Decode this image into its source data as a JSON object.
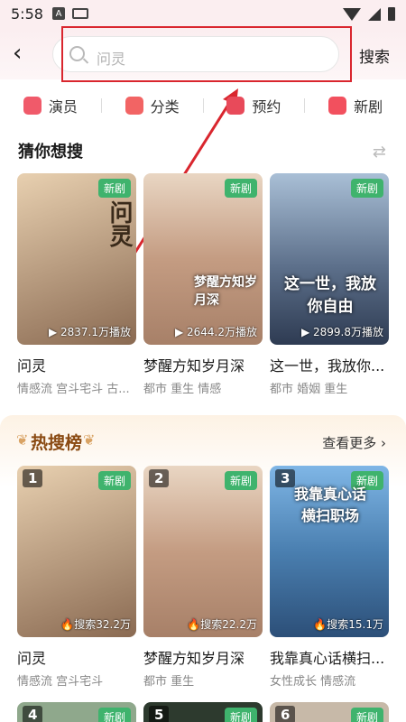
{
  "status": {
    "time": "5:58",
    "a_icon": "A"
  },
  "header": {
    "search_placeholder": "问灵",
    "search_button": "搜索"
  },
  "tabs": [
    {
      "label": "演员",
      "color": "#f05a6a"
    },
    {
      "label": "分类",
      "color": "#f26464"
    },
    {
      "label": "预约",
      "color": "#e84a5a"
    },
    {
      "label": "新剧",
      "color": "#f2505e"
    }
  ],
  "guess": {
    "title": "猜你想搜",
    "items": [
      {
        "title": "问灵",
        "tags": "情感流 宫斗宅斗 古...",
        "plays": "▶ 2837.1万播放",
        "badge": "新剧",
        "poster_text": "问灵",
        "bg": "#c9a27e"
      },
      {
        "title": "梦醒方知岁月深",
        "tags": "都市 重生 情感",
        "plays": "▶ 2644.2万播放",
        "badge": "新剧",
        "poster_text": "梦醒方知岁月深",
        "bg": "#b88e6e"
      },
      {
        "title": "这一世，我放你...",
        "tags": "都市 婚姻 重生",
        "plays": "▶ 2899.8万播放",
        "badge": "新剧",
        "poster_text": "这一世，我放你自由",
        "bg": "#5a6e8c"
      }
    ]
  },
  "hot": {
    "title": "热搜榜",
    "more": "查看更多",
    "items": [
      {
        "rank": "1",
        "title": "问灵",
        "tags": "情感流 宫斗宅斗",
        "search": "搜索32.2万",
        "badge": "新剧",
        "bg": "#c9a27e"
      },
      {
        "rank": "2",
        "title": "梦醒方知岁月深",
        "tags": "都市 重生",
        "search": "搜索22.2万",
        "badge": "新剧",
        "bg": "#b88e6e"
      },
      {
        "rank": "3",
        "title": "我靠真心话横扫...",
        "tags": "女性成长 情感流",
        "search": "搜索15.1万",
        "badge": "新剧",
        "poster_text": "我靠真心话横扫职场",
        "bg": "#4a7fb0"
      }
    ],
    "next_ranks": [
      "4",
      "5",
      "6"
    ],
    "next_badge": "新剧"
  }
}
